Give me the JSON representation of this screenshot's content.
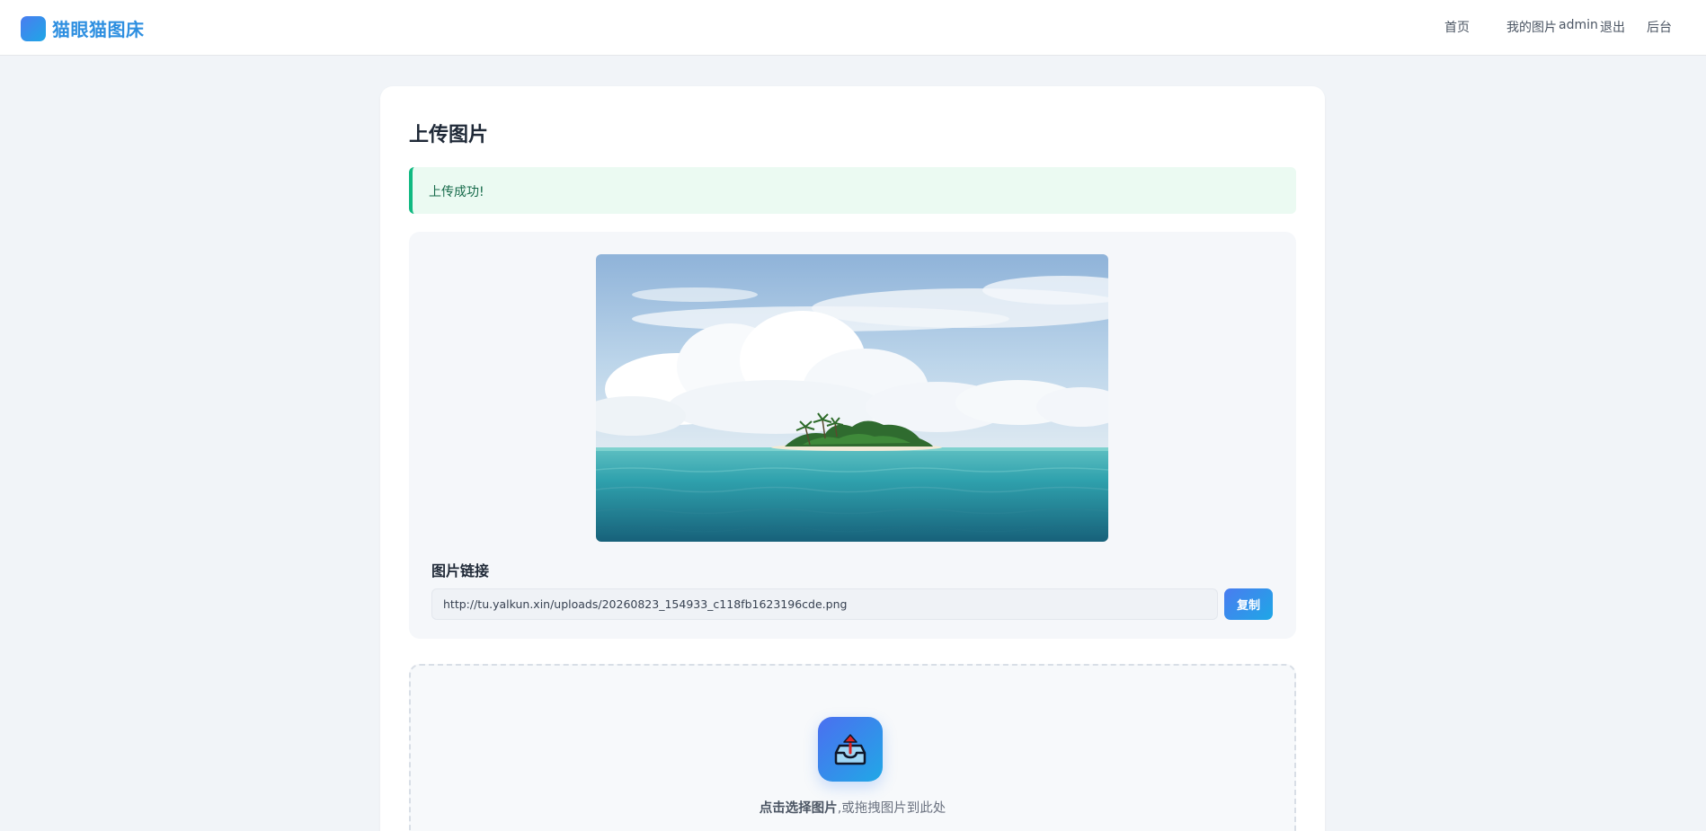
{
  "app": {
    "name": "猫眼猫图床",
    "brand_color": "#2e8fe0"
  },
  "nav": {
    "home": "首页",
    "my_images": "我的图片",
    "user": "admin",
    "logout": "退出",
    "admin_panel": "后台"
  },
  "upload": {
    "title": "上传图片",
    "success_message": "上传成功!",
    "link_label": "图片链接",
    "link_value": "http://tu.yalkun.xin/uploads/20260823_154933_c118fb1623196cde.png",
    "copy_label": "复制",
    "drop_text_bold": "点击选择图片",
    "drop_text_rest": ",或拖拽图片到此处"
  },
  "colors": {
    "accent_start": "#4a7cf0",
    "accent_end": "#1ea7e6",
    "success_border": "#10b981",
    "success_bg": "#ebfaf2"
  },
  "icons": {
    "upload": "upload-tray-icon"
  }
}
